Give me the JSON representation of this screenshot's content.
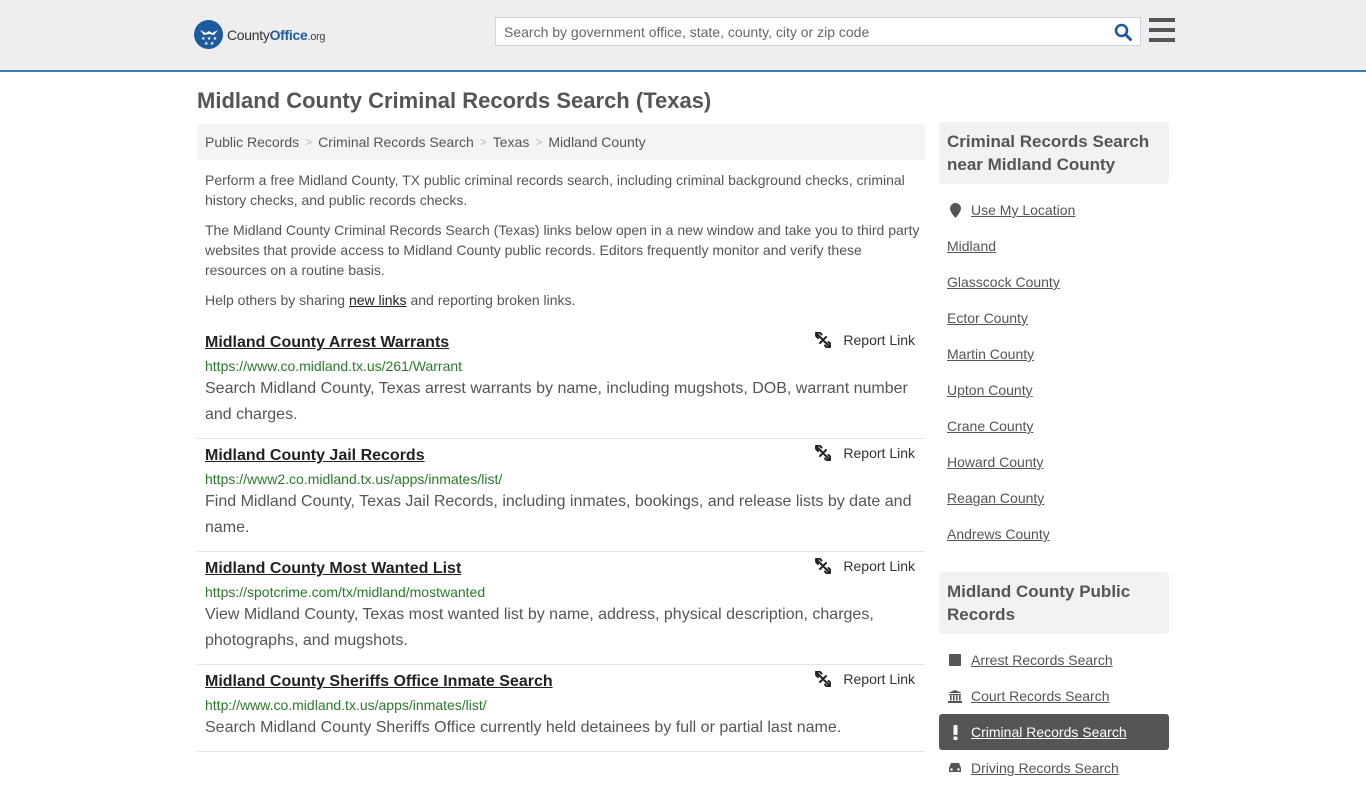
{
  "header": {
    "logo": {
      "name_part1": "County",
      "name_part2": "Office",
      "tld": ".org"
    },
    "search": {
      "placeholder": "Search by government office, state, county, city or zip code",
      "value": ""
    },
    "search_icon": "search-icon",
    "menu_icon": "hamburger-menu-icon",
    "accent_color": "#3c7cb4"
  },
  "page": {
    "title": "Midland County Criminal Records Search (Texas)"
  },
  "breadcrumb": [
    {
      "label": "Public Records"
    },
    {
      "label": "Criminal Records Search"
    },
    {
      "label": "Texas"
    },
    {
      "label": "Midland County"
    }
  ],
  "intro": {
    "p1": "Perform a free Midland County, TX public criminal records search, including criminal background checks, criminal history checks, and public records checks.",
    "p2": "The Midland County Criminal Records Search (Texas) links below open in a new window and take you to third party websites that provide access to Midland County public records. Editors frequently monitor and verify these resources on a routine basis.",
    "p3_before": "Help others by sharing ",
    "p3_link": "new links",
    "p3_after": " and reporting broken links."
  },
  "results": [
    {
      "title": "Midland County Arrest Warrants",
      "url": "https://www.co.midland.tx.us/261/Warrant",
      "description": "Search Midland County, Texas arrest warrants by name, including mugshots, DOB, warrant number and charges.",
      "report_label": "Report Link"
    },
    {
      "title": "Midland County Jail Records",
      "url": "https://www2.co.midland.tx.us/apps/inmates/list/",
      "description": "Find Midland County, Texas Jail Records, including inmates, bookings, and release lists by date and name.",
      "report_label": "Report Link"
    },
    {
      "title": "Midland County Most Wanted List",
      "url": "https://spotcrime.com/tx/midland/mostwanted",
      "description": "View Midland County, Texas most wanted list by name, address, physical description, charges, photographs, and mugshots.",
      "report_label": "Report Link"
    },
    {
      "title": "Midland County Sheriffs Office Inmate Search",
      "url": "http://www.co.midland.tx.us/apps/inmates/list/",
      "description": "Search Midland County Sheriffs Office currently held detainees by full or partial last name.",
      "report_label": "Report Link"
    }
  ],
  "sidebar": {
    "nearby": {
      "heading": "Criminal Records Search near Midland County",
      "use_location": "Use My Location",
      "items": [
        "Midland",
        "Glasscock County",
        "Ector County",
        "Martin County",
        "Upton County",
        "Crane County",
        "Howard County",
        "Reagan County",
        "Andrews County"
      ]
    },
    "public_records": {
      "heading": "Midland County Public Records",
      "items": [
        {
          "label": "Arrest Records Search",
          "icon": "square-icon",
          "active": false
        },
        {
          "label": "Court Records Search",
          "icon": "courthouse-icon",
          "active": false
        },
        {
          "label": "Criminal Records Search",
          "icon": "exclamation-icon",
          "active": true
        },
        {
          "label": "Driving Records Search",
          "icon": "car-icon",
          "active": false
        }
      ]
    }
  }
}
